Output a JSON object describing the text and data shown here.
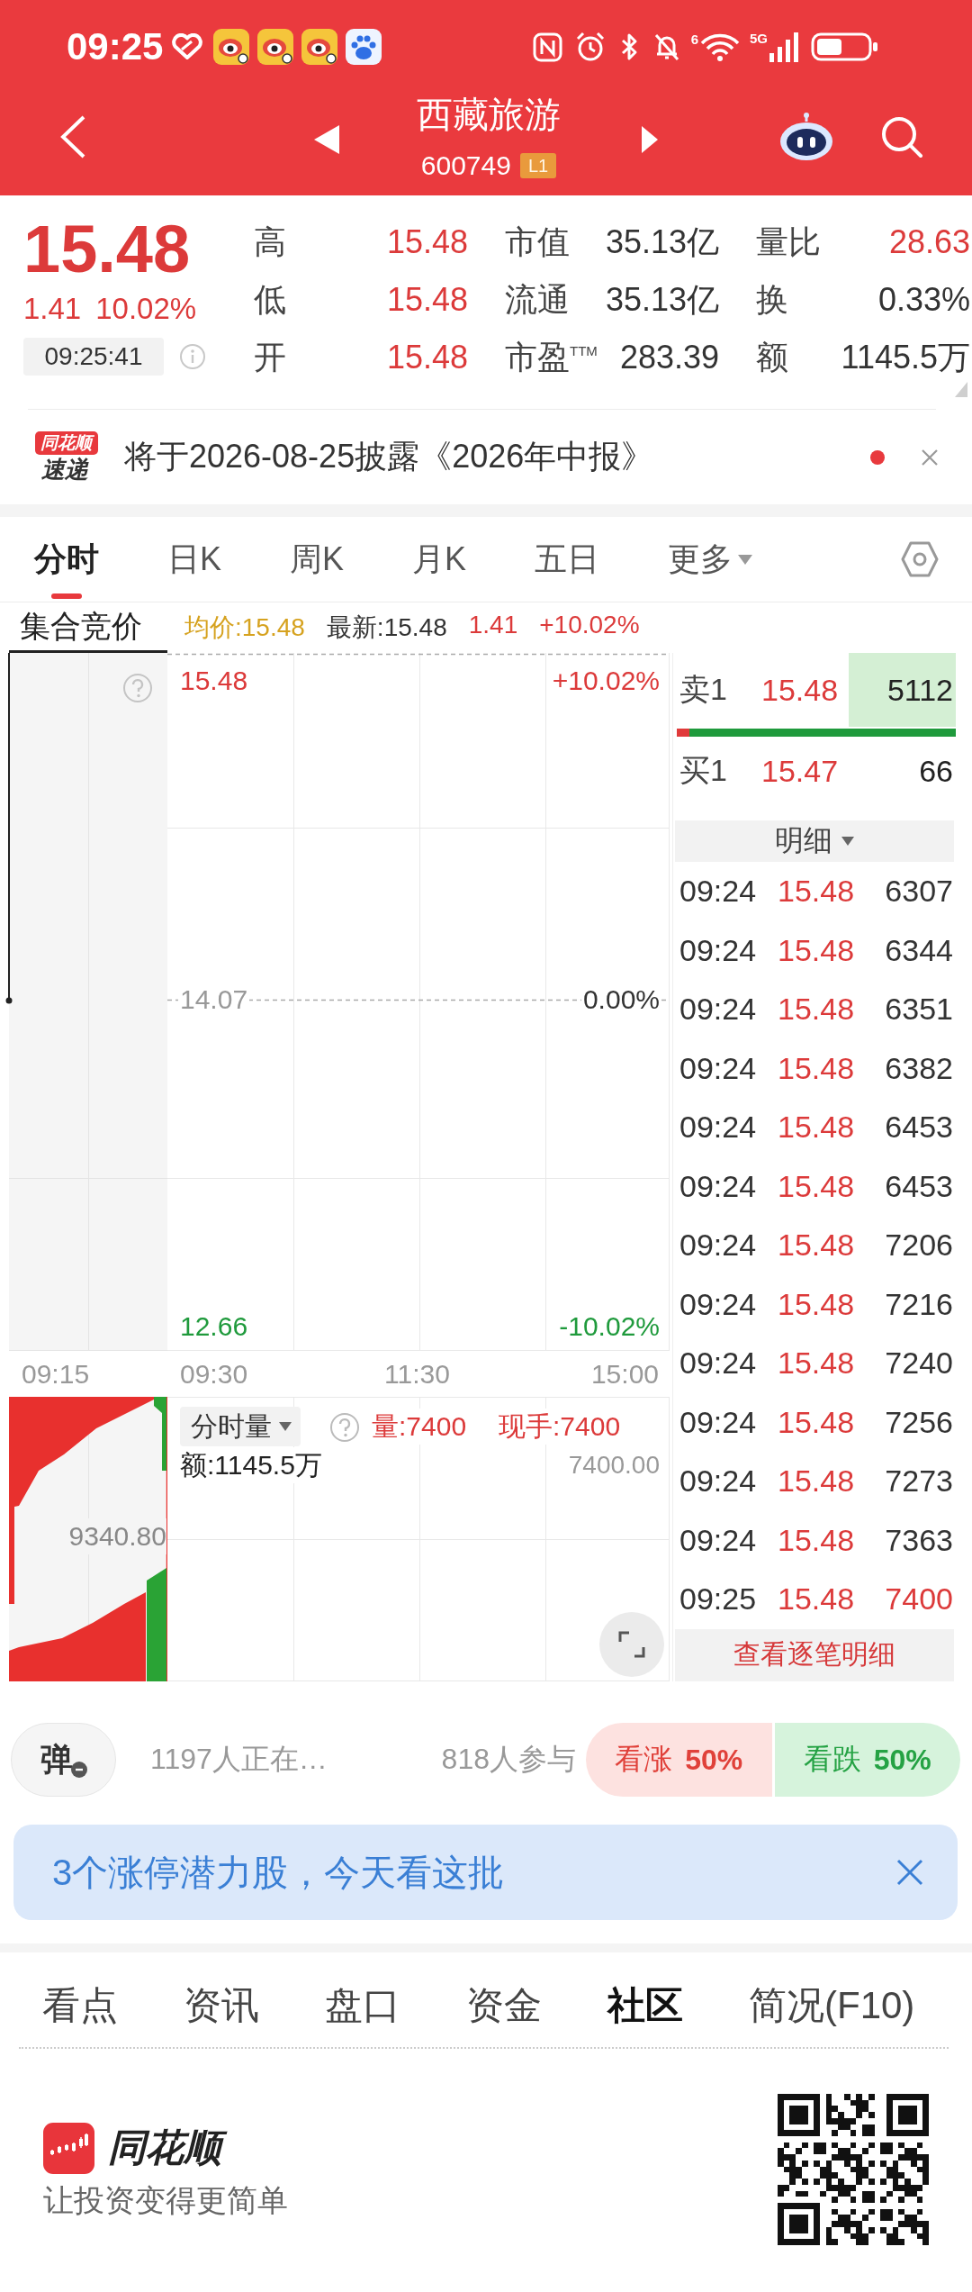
{
  "status_bar": {
    "time": "09:25",
    "wifi_label": "6",
    "network_label": "5G"
  },
  "header": {
    "title": "西藏旅游",
    "code": "600749",
    "level_badge": "L1"
  },
  "quote": {
    "price": "15.48",
    "change": "1.41",
    "change_pct": "10.02%",
    "time": "09:25:41",
    "up": true,
    "stats": [
      {
        "label": "高",
        "value": "15.48",
        "color": "#dc3a3a"
      },
      {
        "label": "市值",
        "value": "35.13亿",
        "color": "#333333"
      },
      {
        "label": "量比",
        "value": "28.63",
        "color": "#dc3a3a"
      },
      {
        "label": "低",
        "value": "15.48",
        "color": "#dc3a3a"
      },
      {
        "label": "流通",
        "value": "35.13亿",
        "color": "#333333"
      },
      {
        "label": "换",
        "value": "0.33%",
        "color": "#333333"
      },
      {
        "label": "开",
        "value": "15.48",
        "color": "#dc3a3a"
      },
      {
        "label": "市盈$^{TTM}$",
        "value": "283.39",
        "color": "#333333"
      },
      {
        "label": "额",
        "value": "1145.5万",
        "color": "#333333"
      }
    ]
  },
  "notice": {
    "logo_top": "同花顺",
    "logo_bottom": "速递",
    "text": "将于2026-08-25披露《2026年中报》",
    "unread": true
  },
  "tabs": [
    {
      "label": "分时",
      "selected": true,
      "kind": "tab"
    },
    {
      "label": "日K",
      "selected": false,
      "kind": "tab"
    },
    {
      "label": "周K",
      "selected": false,
      "kind": "tab"
    },
    {
      "label": "月K",
      "selected": false,
      "kind": "tab"
    },
    {
      "label": "五日",
      "selected": false,
      "kind": "tab"
    },
    {
      "label": "更多",
      "selected": false,
      "kind": "menu"
    }
  ],
  "chart": {
    "session": "集合竞价",
    "average": "均价:15.48",
    "latest": "最新:15.48",
    "change": "1.41",
    "change_pct": "+10.02%",
    "price_labels": [
      {
        "text": "15.48",
        "color": "#dc3a3a"
      },
      {
        "text": "14.07",
        "color": "#999999"
      },
      {
        "text": "12.66",
        "color": "#1f9a3c"
      }
    ],
    "percent_labels": [
      {
        "text": "+10.02%",
        "color": "#dc3a3a"
      },
      {
        "text": "0.00%",
        "color": "#333333"
      },
      {
        "text": "-10.02%",
        "color": "#1f9a3c"
      }
    ],
    "time_axis": [
      "09:15",
      "09:30",
      "11:30",
      "15:00"
    ],
    "volume": {
      "mode": "分时量",
      "volume": "量:7400",
      "current": "现手:7400",
      "amount": "额:1145.5万",
      "axis_max": "7400.00",
      "auction_mid": "9340.80"
    }
  },
  "order_book": {
    "asks": [
      {
        "label": "卖1",
        "price": "15.48",
        "volume": "5112",
        "highlighted": true
      }
    ],
    "ratio_bar": {
      "level": 0.045
    },
    "bids": [
      {
        "label": "买1",
        "price": "15.47",
        "volume": "66",
        "highlighted": false
      }
    ]
  },
  "trades": {
    "header": "明细",
    "rows": [
      {
        "time": "09:24",
        "price": "15.48",
        "volume": "6307",
        "color": "#333333"
      },
      {
        "time": "09:24",
        "price": "15.48",
        "volume": "6344",
        "color": "#333333"
      },
      {
        "time": "09:24",
        "price": "15.48",
        "volume": "6351",
        "color": "#333333"
      },
      {
        "time": "09:24",
        "price": "15.48",
        "volume": "6382",
        "color": "#333333"
      },
      {
        "time": "09:24",
        "price": "15.48",
        "volume": "6453",
        "color": "#333333"
      },
      {
        "time": "09:24",
        "price": "15.48",
        "volume": "6453",
        "color": "#333333"
      },
      {
        "time": "09:24",
        "price": "15.48",
        "volume": "7206",
        "color": "#333333"
      },
      {
        "time": "09:24",
        "price": "15.48",
        "volume": "7216",
        "color": "#333333"
      },
      {
        "time": "09:24",
        "price": "15.48",
        "volume": "7240",
        "color": "#333333"
      },
      {
        "time": "09:24",
        "price": "15.48",
        "volume": "7256",
        "color": "#333333"
      },
      {
        "time": "09:24",
        "price": "15.48",
        "volume": "7273",
        "color": "#333333"
      },
      {
        "time": "09:24",
        "price": "15.48",
        "volume": "7363",
        "color": "#333333"
      },
      {
        "time": "09:25",
        "price": "15.48",
        "volume": "7400",
        "color": "#dc3a3a"
      }
    ],
    "footer_link": "查看逐笔明细"
  },
  "sentiment": {
    "danmaku": "弹",
    "watching": "1197人正在…",
    "participants": "818人参与",
    "bull": {
      "label": "看涨",
      "pct": "50%"
    },
    "bear": {
      "label": "看跌",
      "pct": "50%"
    }
  },
  "promo": {
    "text": "3个涨停潜力股，今天看这批"
  },
  "bottom_tabs": [
    {
      "label": "看点",
      "selected": false
    },
    {
      "label": "资讯",
      "selected": false
    },
    {
      "label": "盘口",
      "selected": false
    },
    {
      "label": "资金",
      "selected": false
    },
    {
      "label": "社区",
      "selected": true
    },
    {
      "label": "简况(F10)",
      "selected": false
    }
  ],
  "footer": {
    "brand": "同花顺",
    "slogan": "让投资变得更简单"
  }
}
